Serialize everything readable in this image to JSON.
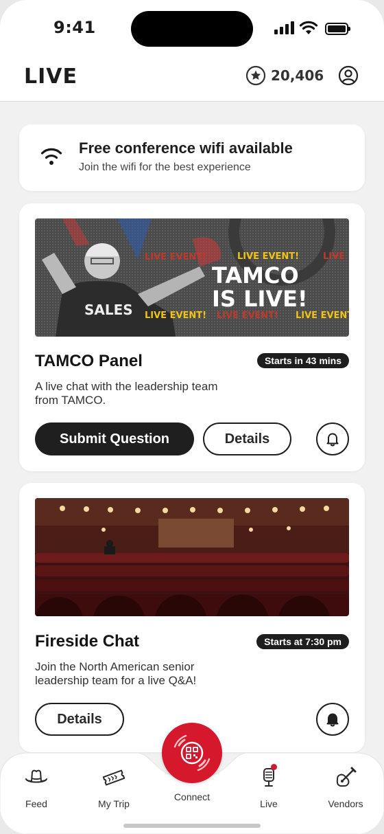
{
  "status_bar": {
    "time": "9:41"
  },
  "header": {
    "title": "LIVE",
    "points": "20,406"
  },
  "wifi_notice": {
    "title": "Free conference wifi available",
    "subtitle": "Join the wifi for the best experience"
  },
  "events": [
    {
      "banner_text": {
        "line1": "TAMCO",
        "line2": "IS LIVE!",
        "ticker": "LIVE EVENT!",
        "shirt": "SALES"
      },
      "title": "TAMCO Panel",
      "badge": "Starts in 43 mins",
      "description": "A live chat with the leadership team from TAMCO.",
      "primary_button": "Submit Question",
      "details_button": "Details"
    },
    {
      "title": "Fireside Chat",
      "badge": "Starts at 7:30 pm",
      "description": "Join the North American senior leadership team for a live Q&A!",
      "details_button": "Details"
    }
  ],
  "nav": {
    "feed": "Feed",
    "my_trip": "My Trip",
    "connect": "Connect",
    "live": "Live",
    "vendors": "Vendors"
  },
  "colors": {
    "accent": "#d5182b",
    "dark": "#1f1f1f",
    "background": "#f1f1f1"
  },
  "icons": {
    "points": "star-icon",
    "profile": "user-circle-icon",
    "wifi": "wifi-icon",
    "bell": "bell-icon",
    "feed": "cowboy-hat-icon",
    "my_trip": "ticket-icon",
    "connect": "qr-code-icon",
    "live": "microphone-icon",
    "vendors": "guitar-icon"
  }
}
